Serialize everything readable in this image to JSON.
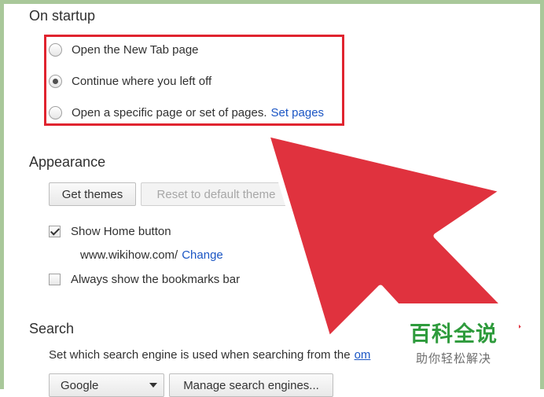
{
  "startup": {
    "title": "On startup",
    "options": [
      {
        "label": "Open the New Tab page",
        "checked": false
      },
      {
        "label": "Continue where you left off",
        "checked": true
      },
      {
        "label": "Open a specific page or set of pages.",
        "checked": false,
        "link": "Set pages"
      }
    ]
  },
  "appearance": {
    "title": "Appearance",
    "get_themes": "Get themes",
    "reset_theme": "Reset to default theme",
    "show_home": {
      "label": "Show Home button",
      "checked": true
    },
    "home_url": "www.wikihow.com/",
    "home_change": "Change",
    "bookmarks_bar": {
      "label": "Always show the bookmarks bar",
      "checked": false
    }
  },
  "search": {
    "title": "Search",
    "description": "Set which search engine is used when searching from the",
    "description_link": "om",
    "engine_selected": "Google",
    "manage_button": "Manage search engines..."
  },
  "watermark": {
    "title": "百科全说",
    "subtitle": "助你轻松解决"
  },
  "colors": {
    "highlight": "#e0242f",
    "arrow": "#e0323e",
    "link": "#1a55c4",
    "frame": "#a9c89a",
    "watermark_green": "#2e9b3c"
  }
}
